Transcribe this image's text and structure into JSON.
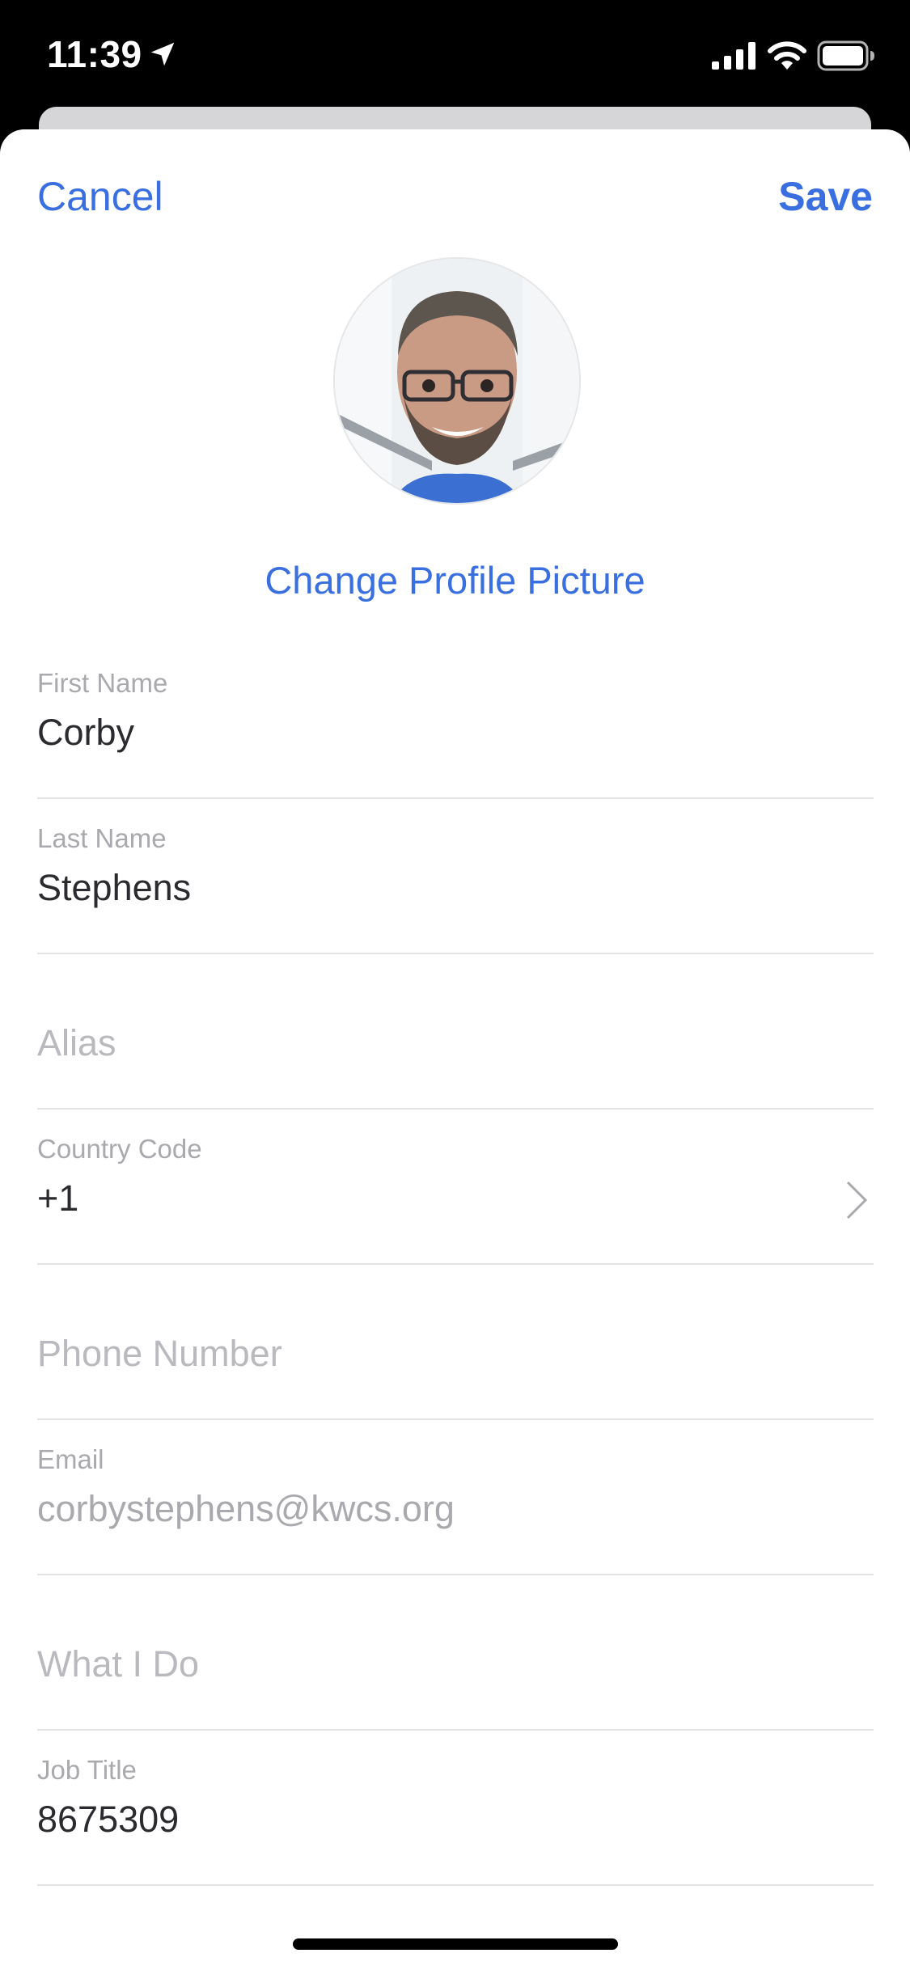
{
  "status_bar": {
    "time": "11:39",
    "icons": [
      "location-arrow-icon",
      "cellular-signal-icon",
      "wifi-icon",
      "battery-icon"
    ]
  },
  "nav": {
    "cancel_label": "Cancel",
    "save_label": "Save"
  },
  "profile": {
    "change_picture_label": "Change Profile Picture"
  },
  "fields": [
    {
      "label": "First Name",
      "value": "Corby"
    },
    {
      "label": "Last Name",
      "value": "Stephens"
    },
    {
      "placeholder": "Alias"
    },
    {
      "label": "Country Code",
      "value": "+1"
    },
    {
      "placeholder": "Phone Number"
    },
    {
      "label": "Email",
      "value": "corbystephens@kwcs.org"
    },
    {
      "placeholder": "What I Do"
    },
    {
      "label": "Job Title",
      "value": "8675309"
    }
  ],
  "colors": {
    "accent": "#3a6fe0",
    "label": "#a9a9ae",
    "text": "#2b2b2f",
    "divider": "#e3e3e6"
  }
}
